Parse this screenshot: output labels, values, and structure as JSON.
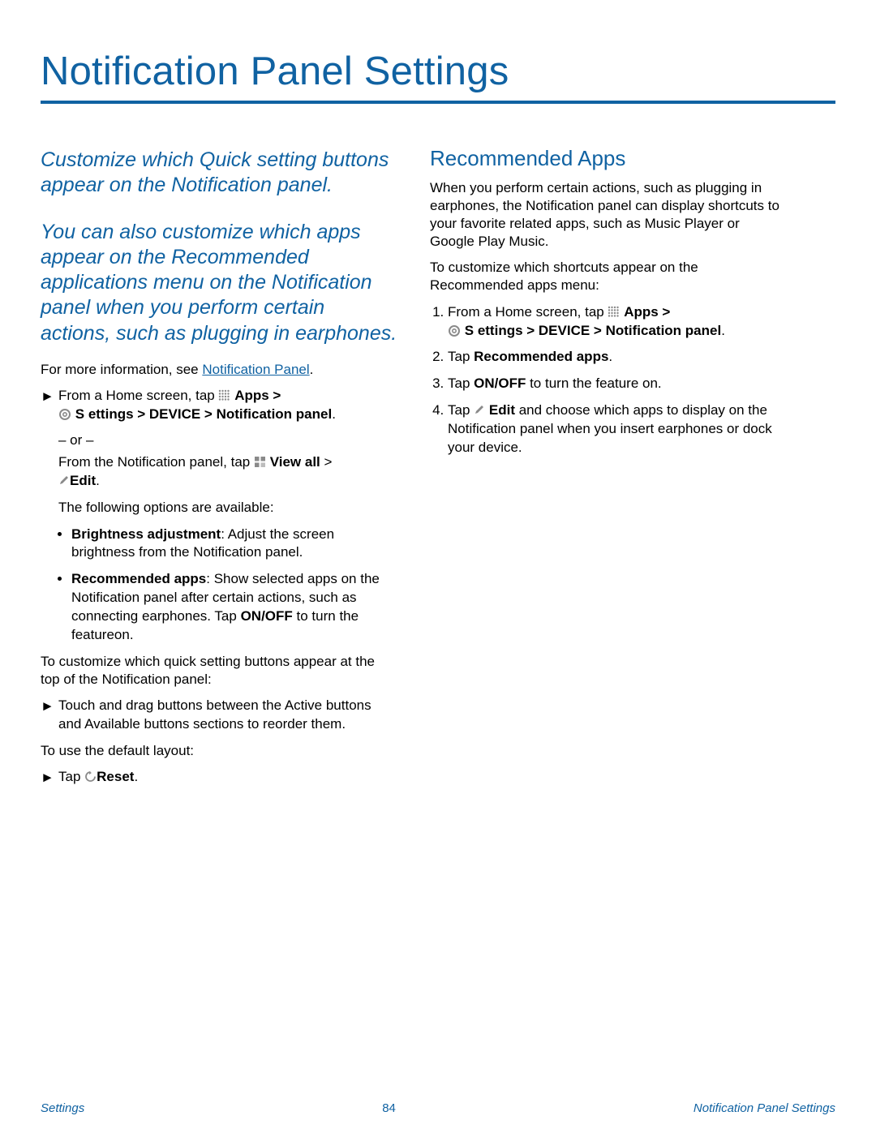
{
  "title": "Notification Panel Settings",
  "intro1": "Customize which Quick setting buttons appear on the Notification panel.",
  "intro2": "You can also customize which apps appear on the Recommended applications menu on the Notification panel when you perform certain actions, such as plugging in earphones.",
  "more_info_prefix": "For more information, see ",
  "more_info_link": "Notification Panel",
  "more_info_suffix": ".",
  "step1_prefix": "From a Home screen, tap ",
  "apps_label": "Apps",
  "gt": " > ",
  "settings_path": "ettings > DEVICE > Notification panel",
  "settings_s": "S",
  "or": "– or –",
  "step1b_prefix": "From the Notification panel, tap ",
  "view_all": "View all",
  "edit_label": "Edit",
  "period": ".",
  "space_gt": "  > ",
  "options_intro": "The following options are available:",
  "bullet1_label": "Brightness adjustment",
  "bullet1_text": ": Adjust the screen brightness from the Notification panel.",
  "bullet2_label": "Recommended apps",
  "bullet2_text_a": ": Show selected apps on the Notification panel after certain actions, such as connecting earphones. Tap ",
  "onoff": "ON/OFF",
  "bullet2_text_b": " to turn the featureon.",
  "customize_para": "To customize which quick setting buttons appear at the top of the Notification panel:",
  "drag_step": "Touch and drag buttons between the Active buttons and Available buttons sections to reorder them.",
  "default_para": "To use the default layout:",
  "tap_word": "Tap ",
  "reset_label": "Reset",
  "right": {
    "heading": "Recommended Apps",
    "p1": "When you perform certain actions, such as plugging in earphones, the Notification panel can display shortcuts to your favorite related apps, such as Music Player or Google Play Music.",
    "p2": "To customize which shortcuts appear on the Recommended apps menu:",
    "li2_a": "Tap ",
    "li2_b": "Recommended apps",
    "li3_a": "Tap ",
    "li3_b": " to turn the feature on.",
    "li4_a": "Tap ",
    "li4_b": "Edit",
    "li4_c": " and choose which apps to display on the Notification panel when you insert earphones or dock your device."
  },
  "footer": {
    "left": "Settings",
    "center": "84",
    "right": "Notification Panel Settings"
  }
}
